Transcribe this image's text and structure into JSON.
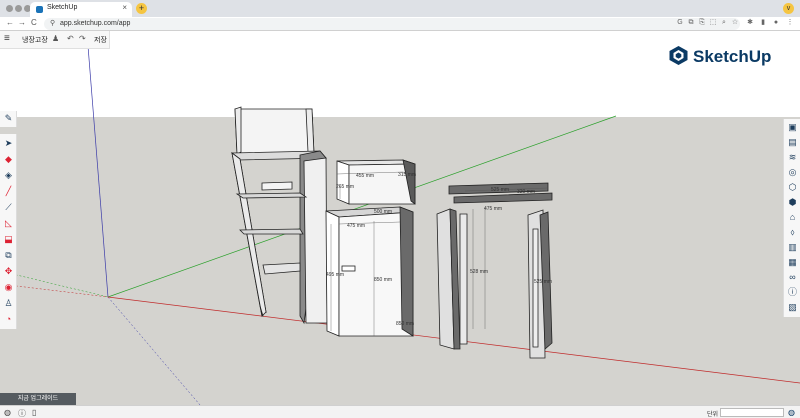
{
  "browser": {
    "tab_title": "SketchUp",
    "tab_close": "×",
    "new_tab": "+",
    "url": "app.sketchup.com/app",
    "back": "←",
    "forward": "→",
    "reload": "C",
    "profile_menu": "v"
  },
  "app": {
    "model_name": "냉장고장",
    "save_label": "저장",
    "logo_text": "SketchUp",
    "upgrade_button": "지금 업그레이드",
    "unit_label": "단위",
    "brand_color": "#0b3a64"
  },
  "dimensions": [
    {
      "id": "microwave-width",
      "label": "455 mm"
    },
    {
      "id": "microwave-depth",
      "label": "315 mm"
    },
    {
      "id": "microwave-height",
      "label": "265 mm"
    },
    {
      "id": "fridge-width",
      "label": "475 mm"
    },
    {
      "id": "fridge-depth",
      "label": "500 mm"
    },
    {
      "id": "fridge-height",
      "label": "850 mm"
    },
    {
      "id": "fridge-side",
      "label": "850 mm"
    },
    {
      "id": "fridge-front",
      "label": "495 mm"
    },
    {
      "id": "shelf-width",
      "label": "525 mm"
    },
    {
      "id": "shelf-depth",
      "label": "320 mm"
    },
    {
      "id": "shelf-inner",
      "label": "475 mm"
    },
    {
      "id": "door-height",
      "label": "528 mm"
    },
    {
      "id": "panel-height",
      "label": "525 mm"
    }
  ],
  "icons": {
    "left_toolbar": [
      "select-icon",
      "eraser-icon",
      "paint-bucket-icon",
      "pencil-icon",
      "line-icon",
      "rectangle-icon",
      "push-pull-icon",
      "offset-icon",
      "move-icon",
      "orbit-icon",
      "walk-icon",
      "section-icon"
    ],
    "right_toolbar": [
      "entity-info-icon",
      "layers-icon",
      "scenes-icon",
      "materials-icon",
      "components-icon",
      "styles-icon",
      "tags-icon",
      "outliner-icon",
      "extension-icon",
      "display-icon",
      "glasses-icon",
      "info-icon",
      "export-icon"
    ]
  }
}
